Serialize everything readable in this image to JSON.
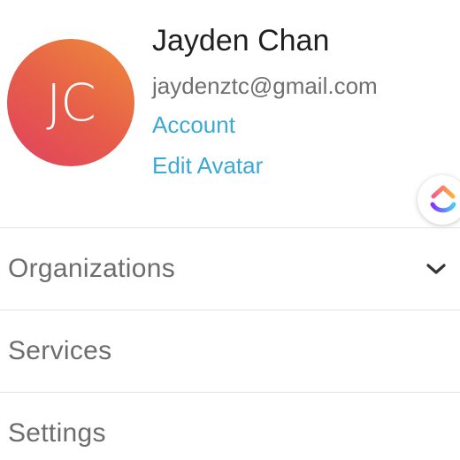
{
  "profile": {
    "initials": "JC",
    "name": "Jayden Chan",
    "email": "jaydenztc@gmail.com",
    "account_link": "Account",
    "edit_avatar_link": "Edit Avatar",
    "avatar_gradient": [
      "#e0415e",
      "#ee8b3a"
    ]
  },
  "colors": {
    "link": "#3aa9d4",
    "menu_text": "#6d6d6d",
    "divider": "#e2e2e2"
  },
  "floating_badge": {
    "icon": "clickup-logo-icon"
  },
  "menu": {
    "items": [
      {
        "label": "Organizations",
        "icon": "chevron-down-icon"
      },
      {
        "label": "Services"
      },
      {
        "label": "Settings"
      }
    ]
  }
}
